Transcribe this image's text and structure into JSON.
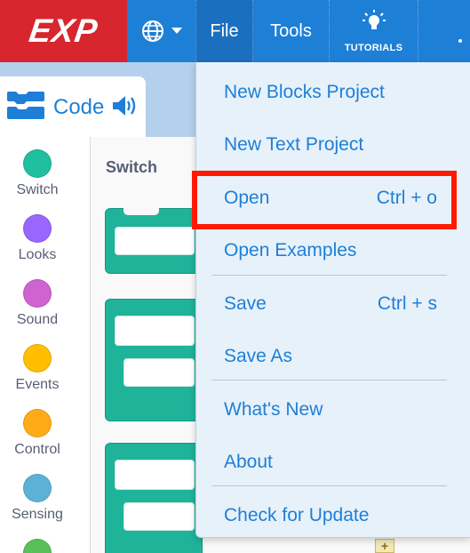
{
  "menubar": {
    "logo": "EXP",
    "file_label": "File",
    "tools_label": "Tools",
    "tutorials_label": "TUTORIALS"
  },
  "code_tab": {
    "label": "Code"
  },
  "categories": [
    {
      "label": "Switch",
      "color": "#1fbf9f"
    },
    {
      "label": "Looks",
      "color": "#9966ff"
    },
    {
      "label": "Sound",
      "color": "#cf63cf"
    },
    {
      "label": "Events",
      "color": "#ffbf00"
    },
    {
      "label": "Control",
      "color": "#ffab19"
    },
    {
      "label": "Sensing",
      "color": "#5cb1d6"
    },
    {
      "label": "",
      "color": "#59c059"
    }
  ],
  "palette": {
    "title": "Switch"
  },
  "file_menu": {
    "items": [
      {
        "label": "New Blocks Project",
        "shortcut": ""
      },
      {
        "label": "New Text Project",
        "shortcut": ""
      },
      {
        "label": "Open",
        "shortcut": "Ctrl + o"
      },
      {
        "label": "Open Examples",
        "shortcut": ""
      },
      {
        "label": "Save",
        "shortcut": "Ctrl + s"
      },
      {
        "label": "Save As",
        "shortcut": ""
      },
      {
        "label": "What's New",
        "shortcut": ""
      },
      {
        "label": "About",
        "shortcut": ""
      },
      {
        "label": "Check for Update",
        "shortcut": ""
      }
    ]
  },
  "colors": {
    "menubar": "#1e7fd6",
    "logo_bg": "#d7262e",
    "menu_text": "#1e7fd6",
    "highlight": "#ff1a00",
    "block": "#1fb39a"
  }
}
